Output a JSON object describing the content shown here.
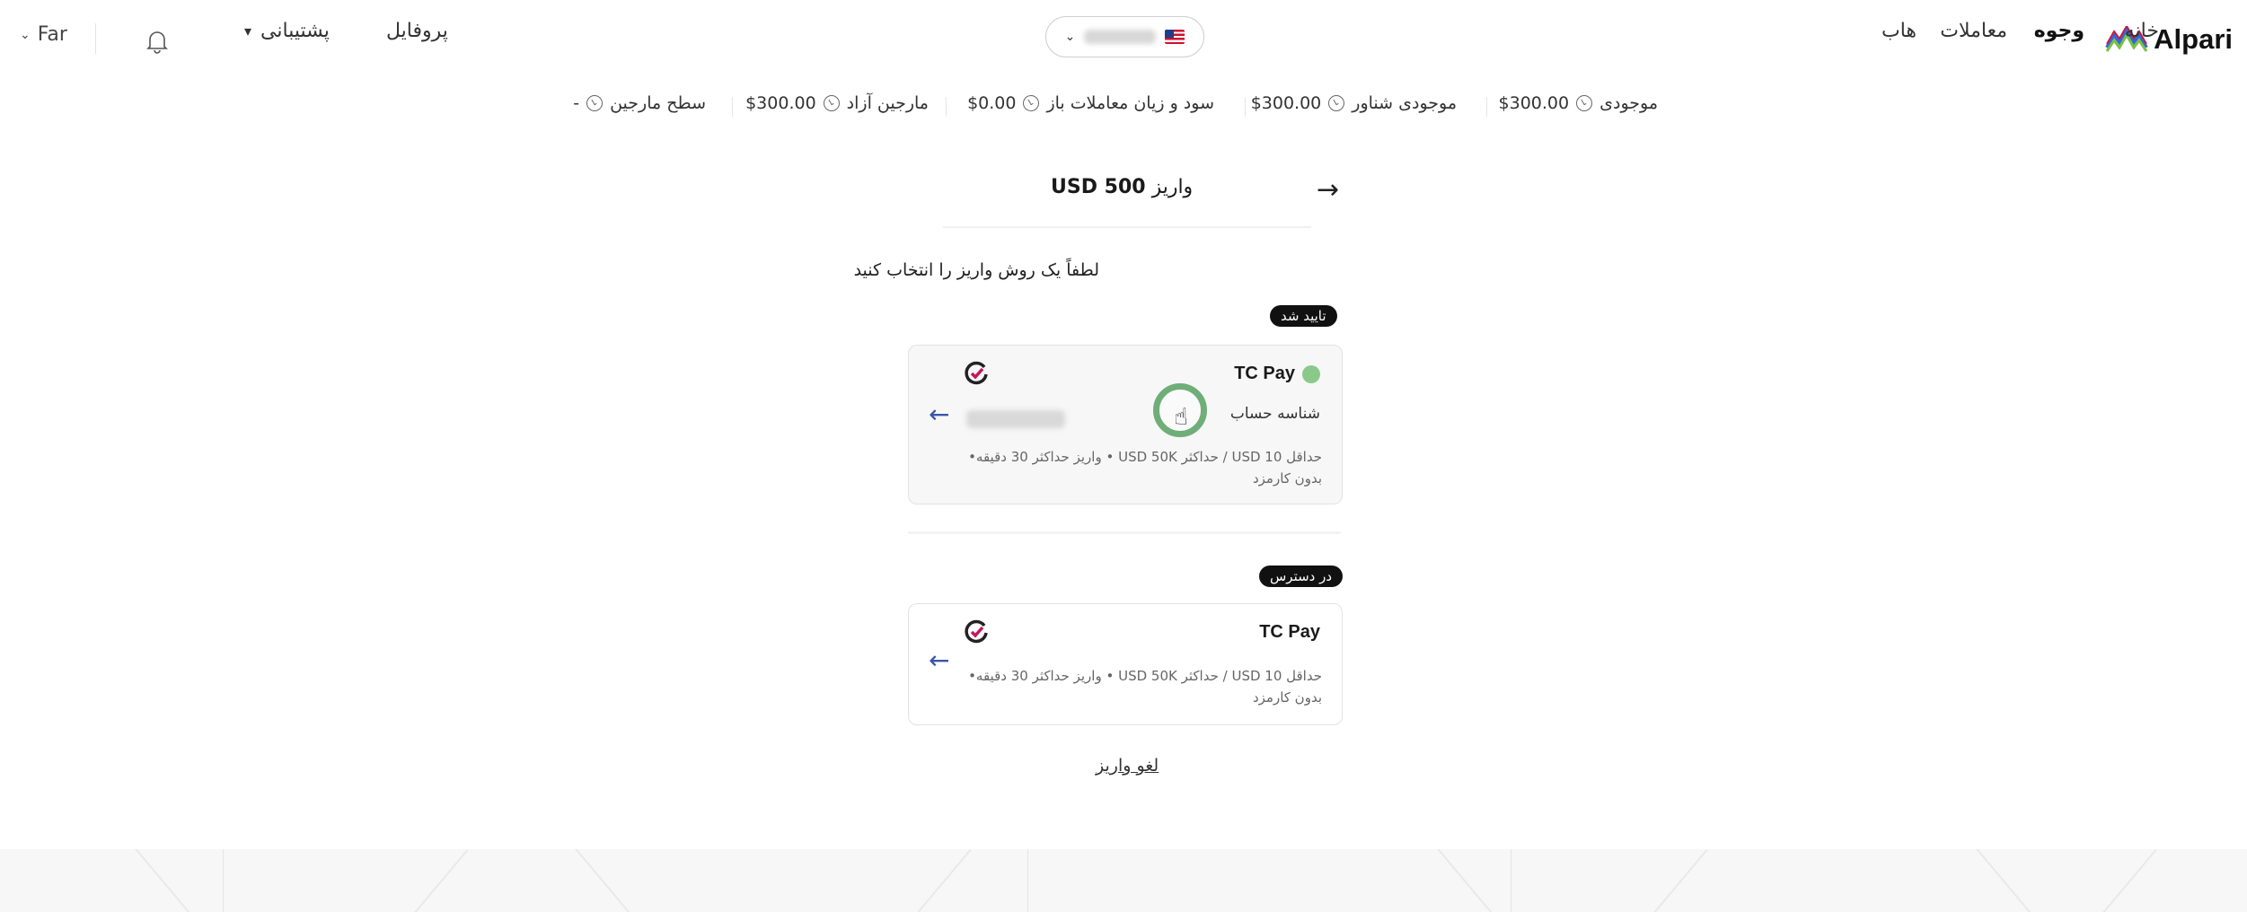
{
  "nav": {
    "logo": "Alpari",
    "items": [
      "خانه",
      "وجوه",
      "معاملات",
      "هاب"
    ],
    "active_index": 1,
    "profile": "پروفایل",
    "support": "پشتیبانی",
    "language": "Far"
  },
  "stats": [
    {
      "label": "موجودی",
      "value": "$300.00"
    },
    {
      "label": "موجودی شناور",
      "value": "$300.00"
    },
    {
      "label": "سود و زیان معاملات باز",
      "value": "$0.00"
    },
    {
      "label": "مارجین آزاد",
      "value": "$300.00"
    },
    {
      "label": "سطح مارجین",
      "value": "-"
    }
  ],
  "deposit": {
    "title_prefix": "واریز",
    "title_amount": "USD 500",
    "instruction": "لطفاً یک روش واریز را انتخاب کنید",
    "verified_tag": "تایید شد",
    "available_tag": "در دسترس",
    "cancel": "لغو واریز"
  },
  "methods": [
    {
      "name": "TC Pay",
      "sub_label": "شناسه حساب",
      "desc_line1": "حداقل USD 10 / حداکثر USD 50K • واریز حداکثر 30 دقیقه•",
      "desc_line2": "بدون کارمزد"
    },
    {
      "name": "TC Pay",
      "desc_line1": "حداقل USD 10 / حداکثر USD 50K • واریز حداکثر 30 دقیقه•",
      "desc_line2": "بدون کارمزد"
    }
  ],
  "colors": {
    "accent": "#3856a8",
    "verified": "#8bc98b",
    "tag_bg": "#111111"
  }
}
